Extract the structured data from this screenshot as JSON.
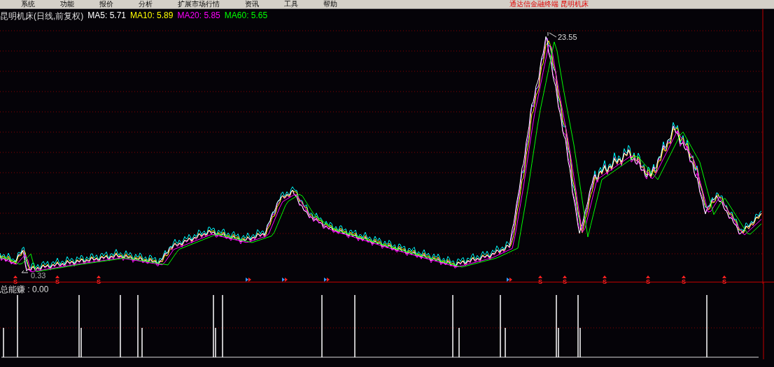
{
  "menu_bar": {
    "items": [
      "系统",
      "功能",
      "报价",
      "分析",
      "扩展市场行情",
      "资讯",
      "工具",
      "帮助"
    ],
    "title": "通达信金融终端 昆明机床"
  },
  "price_panel": {
    "title": "昆明机床(日线,前复权)",
    "indicators": [
      {
        "label": "MA5:",
        "value": "5.71",
        "color": "#ffffff"
      },
      {
        "label": "MA10:",
        "value": "5.89",
        "color": "#ffff00"
      },
      {
        "label": "MA20:",
        "value": "5.85",
        "color": "#ff00ff"
      },
      {
        "label": "MA60:",
        "value": "5.65",
        "color": "#00ff00"
      }
    ],
    "high_label": "23.55",
    "low_label": "0.33",
    "signals": [
      {
        "kind": "sell",
        "label": "S"
      },
      {
        "kind": "sell",
        "label": "S"
      },
      {
        "kind": "sell",
        "label": "S"
      },
      {
        "kind": "buy"
      },
      {
        "kind": "buy"
      },
      {
        "kind": "buy"
      },
      {
        "kind": "buy"
      },
      {
        "kind": "sell",
        "label": "S"
      },
      {
        "kind": "sell",
        "label": "S"
      },
      {
        "kind": "sell",
        "label": "S"
      },
      {
        "kind": "sell",
        "label": "S"
      },
      {
        "kind": "sell",
        "label": "S"
      },
      {
        "kind": "sell",
        "label": "S"
      }
    ]
  },
  "indicator_panel": {
    "label": "总能赚 : 0.00"
  }
}
